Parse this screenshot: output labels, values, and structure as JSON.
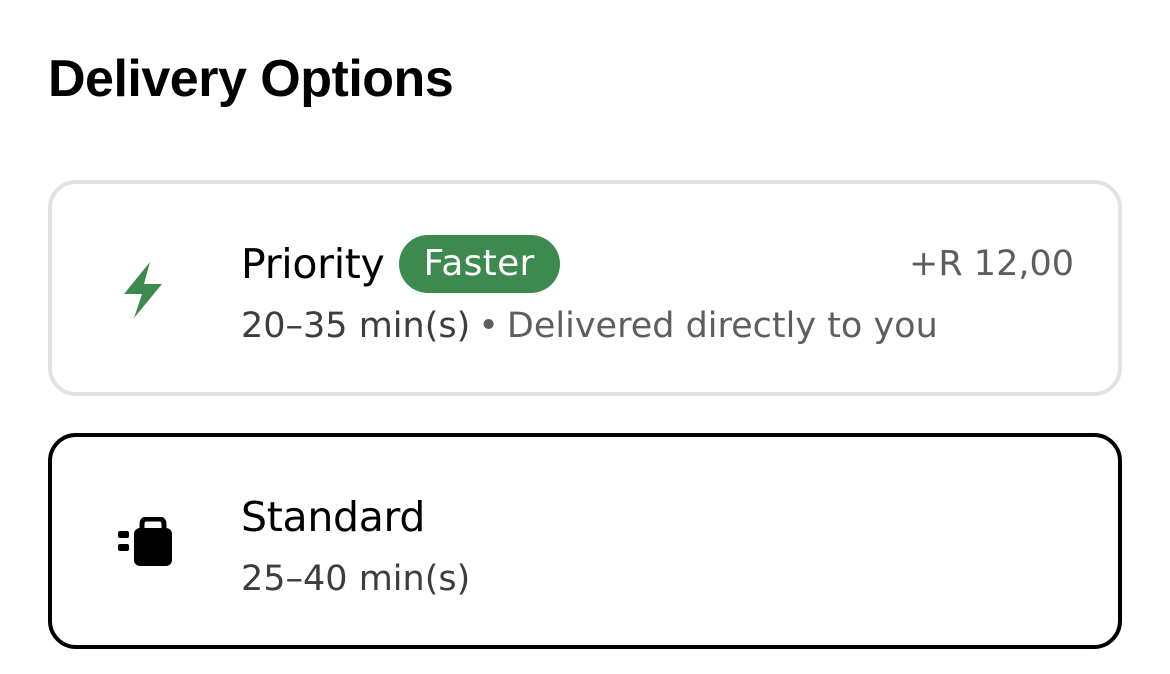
{
  "page": {
    "title": "Delivery Options"
  },
  "options": [
    {
      "name": "Priority",
      "badge": "Faster",
      "price": "+R 12,00",
      "time": "20–35 min(s)",
      "separator": "•",
      "description": "Delivered directly to you",
      "icon": "lightning-bolt-icon",
      "selected": false
    },
    {
      "name": "Standard",
      "time": "25–40 min(s)",
      "icon": "delivery-bag-icon",
      "selected": true
    }
  ],
  "colors": {
    "badge_bg": "#3d8a4f",
    "priority_icon": "#3d8a4f",
    "selected_border": "#000000",
    "unselected_border": "#e2e2e2",
    "secondary_text": "#5e5e5e"
  }
}
